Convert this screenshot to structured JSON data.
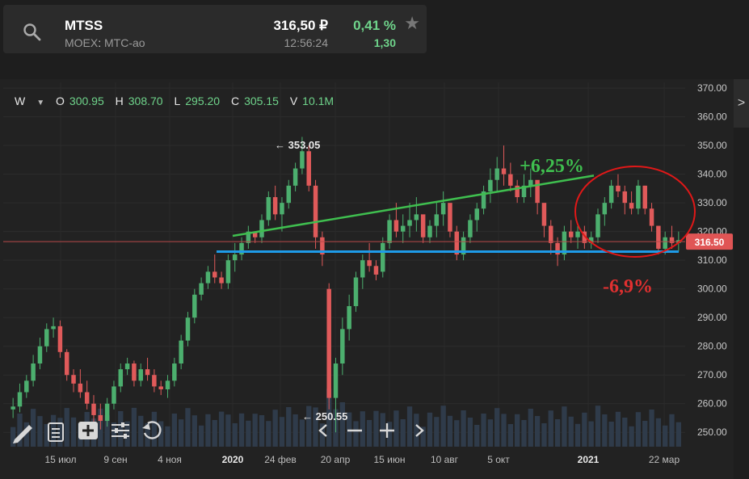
{
  "ticker": {
    "symbol": "MTSS",
    "exchange_prefix": "MOEX",
    "exchange_sep": ":",
    "exchange_name": "МТС-ао",
    "price": "316,50 ₽",
    "time": "12:56:24",
    "change_pct": "0,41 %",
    "change_abs": "1,30",
    "star_icon": "star-icon",
    "search_icon": "search-icon"
  },
  "ohlc": {
    "timeframe": "W",
    "o_label": "O",
    "o_value": "300.95",
    "h_label": "H",
    "h_value": "308.70",
    "l_label": "L",
    "l_value": "295.20",
    "c_label": "C",
    "c_value": "305.15",
    "v_label": "V",
    "v_value": "10.1M"
  },
  "chart_data": {
    "type": "candlestick",
    "y_ticks": [
      "370.00",
      "360.00",
      "350.00",
      "340.00",
      "330.00",
      "320.00",
      "310.00",
      "300.00",
      "290.00",
      "280.00",
      "270.00",
      "260.00",
      "250.00"
    ],
    "y_range": [
      245,
      372
    ],
    "x_labels": [
      "15 июл",
      "9 сен",
      "4 ноя",
      "2020",
      "24 фев",
      "20 апр",
      "15 июн",
      "10 авг",
      "5 окт",
      "2021",
      "22 мар"
    ],
    "current_price_label": "316.50",
    "current_price": 316.5,
    "high_annotation": "353.05",
    "low_annotation": "250.55",
    "support_level": 313,
    "trend_line": {
      "from": 318.5,
      "to": 339.5
    },
    "annotation_up": "+6,25%",
    "annotation_down": "-6,9%",
    "candles": [
      [
        258,
        262,
        255,
        259
      ],
      [
        259,
        267,
        257,
        264
      ],
      [
        264,
        270,
        262,
        268
      ],
      [
        268,
        277,
        266,
        274
      ],
      [
        274,
        283,
        272,
        280
      ],
      [
        280,
        288,
        278,
        286
      ],
      [
        286,
        290,
        283,
        287
      ],
      [
        287,
        289,
        276,
        278
      ],
      [
        278,
        279,
        268,
        270
      ],
      [
        270,
        272,
        264,
        267
      ],
      [
        267,
        272,
        262,
        264
      ],
      [
        264,
        268,
        258,
        260
      ],
      [
        260,
        263,
        252,
        256
      ],
      [
        256,
        260,
        251,
        254
      ],
      [
        254,
        262,
        252,
        260
      ],
      [
        260,
        268,
        258,
        266
      ],
      [
        266,
        274,
        264,
        272
      ],
      [
        272,
        276,
        270,
        274
      ],
      [
        274,
        275,
        266,
        268
      ],
      [
        268,
        274,
        266,
        272
      ],
      [
        272,
        276,
        268,
        270
      ],
      [
        270,
        272,
        264,
        266
      ],
      [
        266,
        268,
        263,
        265
      ],
      [
        265,
        270,
        262,
        268
      ],
      [
        268,
        276,
        266,
        274
      ],
      [
        274,
        284,
        272,
        282
      ],
      [
        282,
        292,
        280,
        290
      ],
      [
        290,
        300,
        288,
        298
      ],
      [
        298,
        304,
        296,
        302
      ],
      [
        302,
        308,
        300,
        306
      ],
      [
        306,
        312,
        302,
        304
      ],
      [
        304,
        306,
        300,
        302
      ],
      [
        302,
        312,
        300,
        310
      ],
      [
        310,
        316,
        306,
        312
      ],
      [
        312,
        318,
        310,
        316
      ],
      [
        316,
        322,
        314,
        320
      ],
      [
        320,
        318,
        316,
        318
      ],
      [
        318,
        326,
        316,
        324
      ],
      [
        324,
        334,
        322,
        332
      ],
      [
        332,
        336,
        324,
        326
      ],
      [
        326,
        332,
        320,
        330
      ],
      [
        330,
        338,
        328,
        336
      ],
      [
        336,
        344,
        334,
        342
      ],
      [
        342,
        353,
        340,
        348
      ],
      [
        348,
        350,
        334,
        336
      ],
      [
        336,
        338,
        314,
        318
      ],
      [
        318,
        320,
        308,
        312
      ],
      [
        300,
        302,
        258,
        262
      ],
      [
        262,
        276,
        250,
        274
      ],
      [
        274,
        290,
        270,
        286
      ],
      [
        286,
        298,
        282,
        294
      ],
      [
        294,
        306,
        292,
        304
      ],
      [
        304,
        312,
        300,
        310
      ],
      [
        310,
        316,
        306,
        308
      ],
      [
        308,
        310,
        303,
        305
      ],
      [
        306,
        318,
        304,
        316
      ],
      [
        316,
        326,
        314,
        324
      ],
      [
        324,
        330,
        318,
        320
      ],
      [
        320,
        326,
        316,
        322
      ],
      [
        322,
        330,
        318,
        324
      ],
      [
        324,
        332,
        320,
        326
      ],
      [
        326,
        320,
        316,
        318
      ],
      [
        318,
        324,
        316,
        322
      ],
      [
        322,
        330,
        318,
        326
      ],
      [
        326,
        334,
        322,
        330
      ],
      [
        330,
        326,
        318,
        320
      ],
      [
        320,
        322,
        310,
        312
      ],
      [
        312,
        320,
        310,
        318
      ],
      [
        318,
        326,
        316,
        324
      ],
      [
        324,
        330,
        320,
        328
      ],
      [
        328,
        336,
        326,
        334
      ],
      [
        334,
        342,
        330,
        338
      ],
      [
        338,
        346,
        334,
        342
      ],
      [
        342,
        350,
        336,
        340
      ],
      [
        340,
        344,
        334,
        336
      ],
      [
        336,
        338,
        330,
        332
      ],
      [
        332,
        340,
        330,
        336
      ],
      [
        336,
        342,
        332,
        338
      ],
      [
        338,
        336,
        326,
        330
      ],
      [
        330,
        328,
        318,
        322
      ],
      [
        322,
        324,
        312,
        316
      ],
      [
        316,
        318,
        308,
        312
      ],
      [
        312,
        322,
        310,
        320
      ],
      [
        320,
        324,
        316,
        318
      ],
      [
        318,
        322,
        314,
        320
      ],
      [
        320,
        322,
        314,
        316
      ],
      [
        316,
        320,
        314,
        318
      ],
      [
        318,
        328,
        316,
        326
      ],
      [
        326,
        332,
        322,
        330
      ],
      [
        330,
        338,
        328,
        336
      ],
      [
        336,
        340,
        332,
        334
      ],
      [
        334,
        336,
        326,
        330
      ],
      [
        330,
        334,
        326,
        328
      ],
      [
        328,
        338,
        326,
        336
      ],
      [
        336,
        336,
        326,
        328
      ],
      [
        328,
        330,
        320,
        322
      ],
      [
        322,
        320,
        312,
        314
      ],
      [
        314,
        320,
        312,
        318
      ],
      [
        318,
        322,
        314,
        316
      ],
      [
        316,
        320,
        313,
        317
      ]
    ]
  },
  "toolbar": {
    "pencil_icon": "pencil-icon",
    "list_icon": "list-icon",
    "add_icon": "add-icon",
    "settings_icon": "settings-icon",
    "reset_icon": "reset-icon",
    "prev_icon": "prev-icon",
    "zoom_out_icon": "zoom-out-icon",
    "zoom_in_icon": "zoom-in-icon",
    "next_icon": "next-icon"
  },
  "colors": {
    "up": "#4caf6e",
    "down": "#e05a5a",
    "trend": "#3fbf4f",
    "support": "#1e9be8",
    "price_line": "#b74a4a",
    "circle": "#e01818",
    "annot_up": "#3fbf4f",
    "annot_down": "#e03030"
  }
}
